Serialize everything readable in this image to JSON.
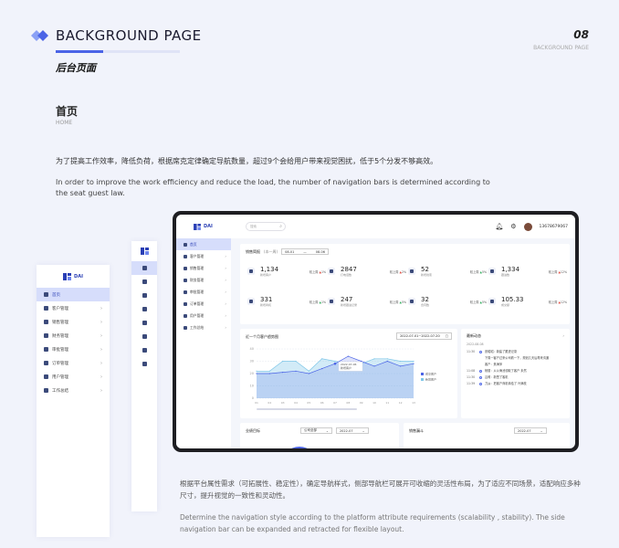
{
  "header": {
    "title": "BACKGROUND PAGE",
    "subtitle_cn": "后台页面",
    "page_number": "08",
    "page_label": "BACKGROUND PAGE"
  },
  "section": {
    "title": "首页",
    "subtitle": "HOME",
    "para_cn": "为了提高工作效率，降低负荷，根据席克定律确定导航数量，超过9个会给用户带来视觉困扰，低于5个分发不够高效。",
    "para_en": "In order to improve the work efficiency and reduce the load, the number of navigation bars is determined according to the seat guest law."
  },
  "brand": {
    "logo_text": "DAI"
  },
  "nav_items": [
    {
      "label": "首页",
      "active": true,
      "chevron": false,
      "icon": "home-icon"
    },
    {
      "label": "客户管理",
      "active": false,
      "chevron": true,
      "icon": "user-icon"
    },
    {
      "label": "销售管理",
      "active": false,
      "chevron": true,
      "icon": "tag-icon"
    },
    {
      "label": "财务管理",
      "active": false,
      "chevron": true,
      "icon": "finance-icon"
    },
    {
      "label": "审批管理",
      "active": false,
      "chevron": true,
      "icon": "approve-icon"
    },
    {
      "label": "订单管理",
      "active": false,
      "chevron": true,
      "icon": "order-icon"
    },
    {
      "label": "用户管理",
      "active": false,
      "chevron": true,
      "icon": "people-icon"
    },
    {
      "label": "工作总结",
      "active": false,
      "chevron": true,
      "icon": "doc-icon"
    }
  ],
  "app": {
    "search_placeholder": "搜索",
    "phone": "13678679067",
    "sales_brief": {
      "title": "销售简报",
      "sub": "(本一周)",
      "date_from": "08-01",
      "date_to": "08-06"
    },
    "stats": [
      {
        "value": "1,134",
        "label": "新增客户",
        "cmp": "较上周",
        "pct": "1%",
        "dir": "up"
      },
      {
        "value": "2847",
        "label": "打电话数",
        "cmp": "较上周",
        "pct": "2%",
        "dir": "up"
      },
      {
        "value": "52",
        "label": "新增线索",
        "cmp": "较上周",
        "pct": "5%",
        "dir": "down"
      },
      {
        "value": "1,334",
        "label": "跟进数",
        "cmp": "较上周",
        "pct": "12%",
        "dir": "up"
      },
      {
        "value": "331",
        "label": "新增商机",
        "cmp": "较上周",
        "pct": "1%",
        "dir": "down"
      },
      {
        "value": "247",
        "label": "新增跟进记录",
        "cmp": "较上周",
        "pct": "5%",
        "dir": "down"
      },
      {
        "value": "32",
        "label": "合同数",
        "cmp": "较上周",
        "pct": "5%",
        "dir": "down"
      },
      {
        "value": "105.33",
        "label": "成交额",
        "cmp": "较上周",
        "pct": "12%",
        "dir": "up"
      }
    ],
    "trend": {
      "title": "近一个月客户趋势图",
      "range": "2022-07-01~2022-07-20",
      "tooltip_date": "2022-07-06",
      "tooltip_label": "新增客户",
      "legend": [
        "成交客户",
        "新增客户"
      ]
    },
    "feed": {
      "title": "最新动态",
      "date": "2022-08-08",
      "items": [
        {
          "time": "11:30",
          "text": "张昭昭：新建了跟进记录"
        },
        {
          "time": "",
          "text": "下周一客户过来公司看一下，规划几天后再来沟通"
        },
        {
          "time": "",
          "text": "客户：焦海萍"
        },
        {
          "time": "11:08",
          "text": "杨丽：从公海池领取了客户 未然"
        },
        {
          "time": "11:30",
          "text": "吕莉：新签了客机"
        },
        {
          "time": "11:39",
          "text": "刀焱：把客户商机转给了 叶满枝"
        }
      ]
    },
    "bottom_left": {
      "title": "业绩目标",
      "sel1": "公司全部",
      "sel2": "2022-07"
    },
    "bottom_right": {
      "title": "销售漏斗",
      "sel1": "2022-07"
    }
  },
  "chart_data": {
    "type": "area",
    "title": "近一个月客户趋势图",
    "categories": [
      "01",
      "02",
      "03",
      "04",
      "05",
      "06",
      "07",
      "08",
      "09",
      "10",
      "11",
      "12",
      "13"
    ],
    "ylim": [
      0,
      40
    ],
    "yticks": [
      0,
      10,
      20,
      30,
      40
    ],
    "series": [
      {
        "name": "成交客户",
        "values": [
          20,
          20,
          21,
          22,
          20,
          24,
          28,
          34,
          30,
          26,
          30,
          26,
          28
        ],
        "color": "#4b64e6"
      },
      {
        "name": "新增客户",
        "values": [
          22,
          22,
          30,
          30,
          22,
          32,
          30,
          28,
          28,
          32,
          32,
          30,
          30
        ],
        "color": "#7fc7e8"
      }
    ]
  }
}
